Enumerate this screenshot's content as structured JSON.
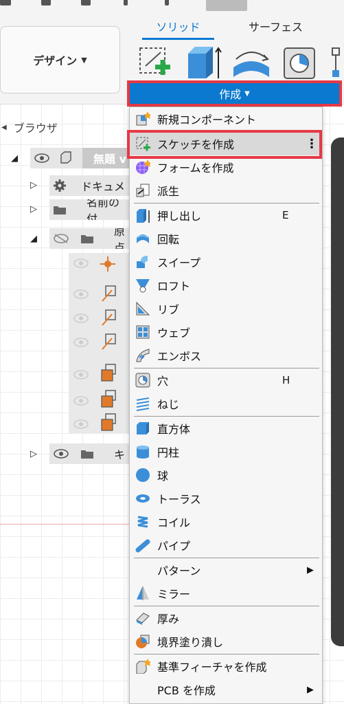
{
  "toolbar": {
    "workspace_label": "デザイン",
    "tabs": [
      "ソリッド",
      "サーフェス"
    ],
    "create_label": "作成"
  },
  "browser": {
    "title": "ブラウザ",
    "root_label": "無題 v",
    "items": [
      "ドキュメ",
      "名前の付",
      "原点",
      "キ"
    ]
  },
  "menu": {
    "items": [
      {
        "label": "新規コンポーネント",
        "icon": "new-component-icon"
      },
      {
        "label": "スケッチを作成",
        "icon": "create-sketch-icon",
        "highlighted": true
      },
      {
        "label": "フォームを作成",
        "icon": "create-form-icon"
      },
      {
        "label": "派生",
        "icon": "derive-icon"
      },
      {
        "label": "押し出し",
        "icon": "extrude-icon",
        "shortcut": "E"
      },
      {
        "label": "回転",
        "icon": "revolve-icon"
      },
      {
        "label": "スイープ",
        "icon": "sweep-icon"
      },
      {
        "label": "ロフト",
        "icon": "loft-icon"
      },
      {
        "label": "リブ",
        "icon": "rib-icon"
      },
      {
        "label": "ウェブ",
        "icon": "web-icon"
      },
      {
        "label": "エンボス",
        "icon": "emboss-icon"
      },
      {
        "label": "穴",
        "icon": "hole-icon",
        "shortcut": "H"
      },
      {
        "label": "ねじ",
        "icon": "thread-icon"
      },
      {
        "label": "直方体",
        "icon": "box-icon"
      },
      {
        "label": "円柱",
        "icon": "cylinder-icon"
      },
      {
        "label": "球",
        "icon": "sphere-icon"
      },
      {
        "label": "トーラス",
        "icon": "torus-icon"
      },
      {
        "label": "コイル",
        "icon": "coil-icon"
      },
      {
        "label": "パイプ",
        "icon": "pipe-icon"
      },
      {
        "label": "パターン",
        "icon": "",
        "submenu": true
      },
      {
        "label": "ミラー",
        "icon": "mirror-icon"
      },
      {
        "label": "厚み",
        "icon": "thicken-icon"
      },
      {
        "label": "境界塗り潰し",
        "icon": "boundary-fill-icon"
      },
      {
        "label": "基準フィーチャを作成",
        "icon": "base-feature-icon"
      },
      {
        "label": "PCB を作成",
        "icon": "",
        "submenu": true
      }
    ]
  },
  "colors": {
    "accent": "#0a79cf",
    "highlight_border": "#e63946",
    "menu_bg": "#f6f6f6",
    "menu_highlight": "#d9d9d9"
  }
}
